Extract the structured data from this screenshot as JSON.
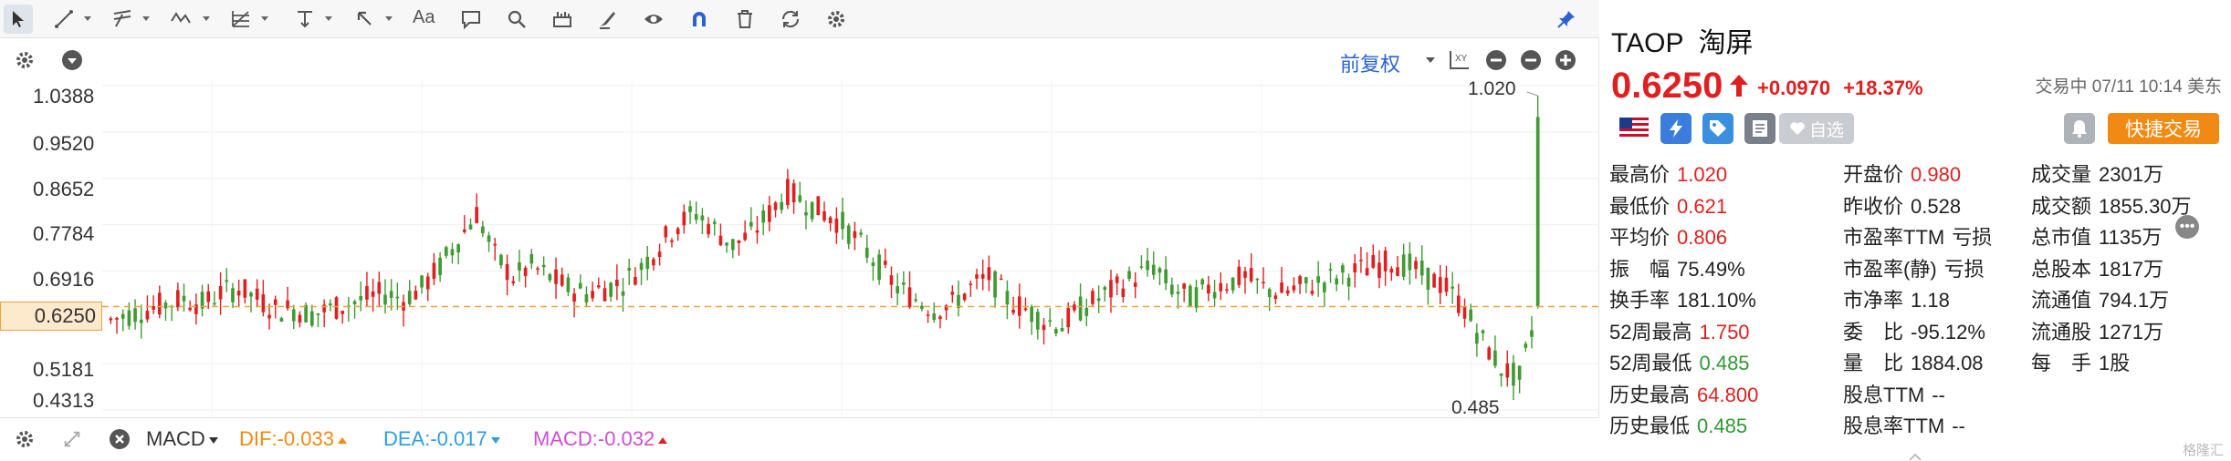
{
  "toolbar": {
    "tools": [
      "cursor-icon",
      "line-tool-icon",
      "channel-tool-icon",
      "wave-tool-icon",
      "fib-tool-icon",
      "hline-tool-icon",
      "arrow-tool-icon",
      "text-tool-icon",
      "comment-icon",
      "search-icon",
      "measure-icon",
      "brush-icon",
      "eye-icon",
      "magnet-icon",
      "trash-icon",
      "sync-icon",
      "gear-icon"
    ],
    "text_tool_label": "Aa",
    "pin_icon": "pin-icon"
  },
  "chart": {
    "adjust_label": "前复权",
    "price_ticks": [
      "1.0388",
      "0.9520",
      "0.8652",
      "0.7784",
      "0.6916",
      "0.6250",
      "0.5181",
      "0.4313"
    ],
    "current_price_tag": "0.6250",
    "high_label": "1.020",
    "low_label": "0.485",
    "colors": {
      "up": "#e02020",
      "down": "#3f9b32",
      "guide": "#f0a13a"
    }
  },
  "chart_data": {
    "type": "candlestick",
    "ylim": [
      0.4313,
      1.0388
    ],
    "current_price": 0.625,
    "visible_high": 1.02,
    "visible_low": 0.485,
    "closes_approx": [
      0.6,
      0.61,
      0.62,
      0.63,
      0.64,
      0.63,
      0.65,
      0.66,
      0.64,
      0.62,
      0.62,
      0.61,
      0.62,
      0.63,
      0.64,
      0.65,
      0.64,
      0.66,
      0.7,
      0.75,
      0.8,
      0.72,
      0.68,
      0.7,
      0.68,
      0.66,
      0.65,
      0.66,
      0.67,
      0.7,
      0.74,
      0.78,
      0.8,
      0.77,
      0.74,
      0.76,
      0.8,
      0.84,
      0.82,
      0.8,
      0.78,
      0.74,
      0.7,
      0.66,
      0.64,
      0.62,
      0.63,
      0.66,
      0.68,
      0.64,
      0.62,
      0.6,
      0.59,
      0.62,
      0.64,
      0.66,
      0.68,
      0.7,
      0.66,
      0.64,
      0.66,
      0.67,
      0.68,
      0.66,
      0.65,
      0.66,
      0.67,
      0.68,
      0.69,
      0.7,
      0.71,
      0.7,
      0.68,
      0.66,
      0.62,
      0.56,
      0.51,
      0.49,
      0.625
    ]
  },
  "macd": {
    "label": "MACD",
    "dif": "DIF:-0.033",
    "dea": "DEA:-0.017",
    "macd": "MACD:-0.032"
  },
  "quote": {
    "ticker": "TAOP",
    "name": "淘屏",
    "price": "0.6250",
    "change": "+0.0970",
    "change_pct": "+18.37%",
    "status": "交易中 07/11 10:14 美东",
    "watch_label": "自选",
    "trade_label": "快捷交易",
    "stats_col1": [
      {
        "label": "最高价",
        "value": "1.020",
        "color": "red"
      },
      {
        "label": "最低价",
        "value": "0.621",
        "color": "red"
      },
      {
        "label": "平均价",
        "value": "0.806",
        "color": "red"
      },
      {
        "label": "振　幅",
        "value": "75.49%",
        "color": "plain"
      },
      {
        "label": "换手率",
        "value": "181.10%",
        "color": "plain"
      },
      {
        "label": "52周最高",
        "value": "1.750",
        "color": "red"
      },
      {
        "label": "52周最低",
        "value": "0.485",
        "color": "green"
      },
      {
        "label": "历史最高",
        "value": "64.800",
        "color": "red"
      },
      {
        "label": "历史最低",
        "value": "0.485",
        "color": "green"
      }
    ],
    "stats_col2": [
      {
        "label": "开盘价",
        "value": "0.980",
        "color": "red"
      },
      {
        "label": "昨收价",
        "value": "0.528",
        "color": "plain"
      },
      {
        "label": "市盈率TTM",
        "value": "亏损",
        "color": "plain"
      },
      {
        "label": "市盈率(静)",
        "value": "亏损",
        "color": "plain"
      },
      {
        "label": "市净率",
        "value": "1.18",
        "color": "plain"
      },
      {
        "label": "委　比",
        "value": "-95.12%",
        "color": "plain"
      },
      {
        "label": "量　比",
        "value": "1884.08",
        "color": "plain"
      },
      {
        "label": "股息TTM",
        "value": "--",
        "color": "plain"
      },
      {
        "label": "股息率TTM",
        "value": "--",
        "color": "plain"
      }
    ],
    "stats_col3": [
      {
        "label": "成交量",
        "value": "2301万",
        "color": "plain"
      },
      {
        "label": "成交额",
        "value": "1855.30万",
        "color": "plain"
      },
      {
        "label": "总市值",
        "value": "1135万",
        "color": "plain"
      },
      {
        "label": "总股本",
        "value": "1817万",
        "color": "plain"
      },
      {
        "label": "流通值",
        "value": "794.1万",
        "color": "plain"
      },
      {
        "label": "流通股",
        "value": "1271万",
        "color": "plain"
      },
      {
        "label": "每　手",
        "value": "1股",
        "color": "plain"
      }
    ],
    "watermark": "格隆汇"
  }
}
